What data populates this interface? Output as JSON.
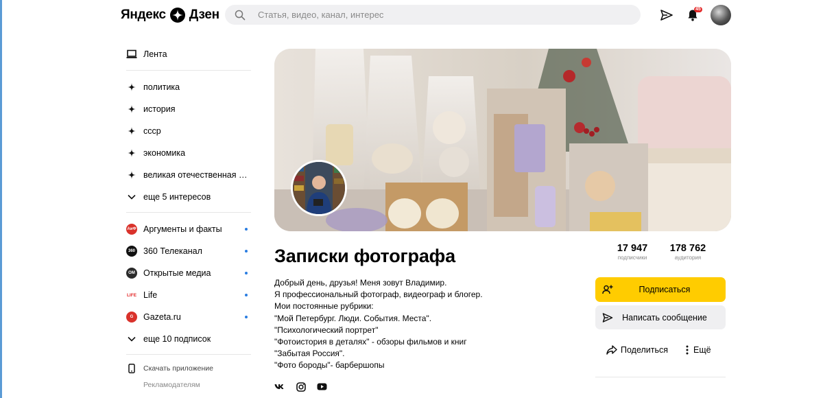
{
  "colors": {
    "accent": "#ffcc00",
    "unread_dot": "#2a7de1",
    "badge": "#e32b2b"
  },
  "header": {
    "logo_text_1": "Яндекс",
    "logo_text_2": "Дзен",
    "search_placeholder": "Статья, видео, канал, интерес",
    "notification_count": "45"
  },
  "sidebar": {
    "feed_label": "Лента",
    "interests": [
      {
        "label": "политика"
      },
      {
        "label": "история"
      },
      {
        "label": "ссср"
      },
      {
        "label": "экономика"
      },
      {
        "label": "великая отечественная во..."
      }
    ],
    "more_interests": "еще 5 интересов",
    "sources": [
      {
        "label": "Аргументы и факты",
        "icon": "aif-logo",
        "unread": true
      },
      {
        "label": "360 Телеканал",
        "icon": "360-logo",
        "unread": true
      },
      {
        "label": "Открытые медиа",
        "icon": "om-logo",
        "unread": true
      },
      {
        "label": "Life",
        "icon": "life-logo",
        "unread": true
      },
      {
        "label": "Gazeta.ru",
        "icon": "gazeta-logo",
        "unread": true
      }
    ],
    "more_subscriptions": "еще 10 подписок",
    "download_app": "Скачать приложение",
    "advertisers": "Рекламодателям"
  },
  "channel": {
    "title": "Записки фотографа",
    "description": [
      "Добрый день, друзья! Меня зовут Владимир.",
      "Я профессиональный фотограф, видеограф и блогер.",
      "Мои постоянные рубрики:",
      "\"Мой Петербург. Люди. События. Места\".",
      "\"Психологический портрет\"",
      "\"Фотоистория в деталях\" - обзоры фильмов и книг",
      "\"Забытая Россия\".",
      "\"Фото бороды\"- барбершопы"
    ],
    "subscribers": {
      "value": "17 947",
      "label": "подписчики"
    },
    "audience": {
      "value": "178 762",
      "label": "аудитория"
    },
    "subscribe_label": "Подписаться",
    "message_label": "Написать сообщение",
    "share_label": "Поделиться",
    "more_label": "Ещё",
    "socials": [
      "vk-icon",
      "instagram-icon",
      "youtube-icon"
    ]
  }
}
